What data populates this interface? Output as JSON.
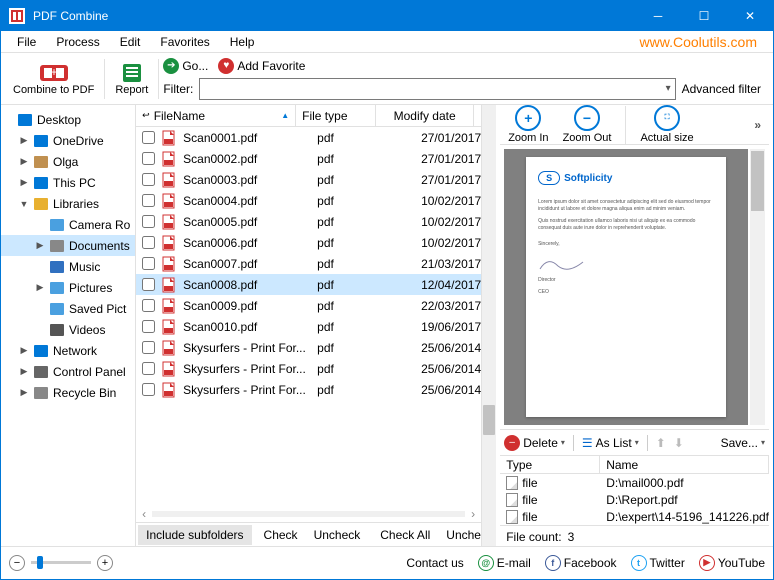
{
  "title": "PDF Combine",
  "brand_url": "www.Coolutils.com",
  "menu": [
    "File",
    "Process",
    "Edit",
    "Favorites",
    "Help"
  ],
  "toolbar": {
    "combine": "Combine to PDF",
    "report": "Report",
    "go": "Go...",
    "add_fav": "Add Favorite",
    "filter_label": "Filter:",
    "advanced": "Advanced filter"
  },
  "tree": [
    {
      "label": "Desktop",
      "icon": "desktop",
      "exp": "",
      "color": "#0078d7"
    },
    {
      "label": "OneDrive",
      "icon": "cloud",
      "exp": "▶",
      "color": "#0078d7",
      "indent": 1
    },
    {
      "label": "Olga",
      "icon": "user",
      "exp": "▶",
      "color": "#c09050",
      "indent": 1
    },
    {
      "label": "This PC",
      "icon": "pc",
      "exp": "▶",
      "color": "#0078d7",
      "indent": 1
    },
    {
      "label": "Libraries",
      "icon": "lib",
      "exp": "▼",
      "color": "#e8b030",
      "indent": 1
    },
    {
      "label": "Camera Ro",
      "icon": "pic",
      "exp": "",
      "color": "#4aa0e0",
      "indent": 2
    },
    {
      "label": "Documents",
      "icon": "doc",
      "exp": "▶",
      "color": "#888",
      "indent": 2,
      "selected": true
    },
    {
      "label": "Music",
      "icon": "music",
      "exp": "",
      "color": "#3070c0",
      "indent": 2
    },
    {
      "label": "Pictures",
      "icon": "pic",
      "exp": "▶",
      "color": "#4aa0e0",
      "indent": 2
    },
    {
      "label": "Saved Pict",
      "icon": "pic",
      "exp": "",
      "color": "#4aa0e0",
      "indent": 2
    },
    {
      "label": "Videos",
      "icon": "vid",
      "exp": "",
      "color": "#555",
      "indent": 2
    },
    {
      "label": "Network",
      "icon": "net",
      "exp": "▶",
      "color": "#0078d7",
      "indent": 1
    },
    {
      "label": "Control Panel",
      "icon": "ctrl",
      "exp": "▶",
      "color": "#666",
      "indent": 1
    },
    {
      "label": "Recycle Bin",
      "icon": "bin",
      "exp": "▶",
      "color": "#888",
      "indent": 1
    }
  ],
  "columns": {
    "name": "FileName",
    "type": "File type",
    "date": "Modify date"
  },
  "files": [
    {
      "name": "Scan0001.pdf",
      "type": "pdf",
      "date": "27/01/2017"
    },
    {
      "name": "Scan0002.pdf",
      "type": "pdf",
      "date": "27/01/2017"
    },
    {
      "name": "Scan0003.pdf",
      "type": "pdf",
      "date": "27/01/2017"
    },
    {
      "name": "Scan0004.pdf",
      "type": "pdf",
      "date": "10/02/2017"
    },
    {
      "name": "Scan0005.pdf",
      "type": "pdf",
      "date": "10/02/2017"
    },
    {
      "name": "Scan0006.pdf",
      "type": "pdf",
      "date": "10/02/2017"
    },
    {
      "name": "Scan0007.pdf",
      "type": "pdf",
      "date": "21/03/2017"
    },
    {
      "name": "Scan0008.pdf",
      "type": "pdf",
      "date": "12/04/2017",
      "selected": true
    },
    {
      "name": "Scan0009.pdf",
      "type": "pdf",
      "date": "22/03/2017"
    },
    {
      "name": "Scan0010.pdf",
      "type": "pdf",
      "date": "19/06/2017"
    },
    {
      "name": "Skysurfers - Print For...",
      "type": "pdf",
      "date": "25/06/2014"
    },
    {
      "name": "Skysurfers - Print For...",
      "type": "pdf",
      "date": "25/06/2014"
    },
    {
      "name": "Skysurfers - Print For...",
      "type": "pdf",
      "date": "25/06/2014"
    }
  ],
  "center_footer": [
    "Include subfolders",
    "Check",
    "Uncheck",
    "Check All",
    "Unche"
  ],
  "zoom": {
    "in": "Zoom In",
    "out": "Zoom Out",
    "actual": "Actual size"
  },
  "preview": {
    "brand": "Softplicity"
  },
  "queue_tb": {
    "delete": "Delete",
    "aslist": "As List",
    "save": "Save..."
  },
  "queue_cols": {
    "type": "Type",
    "name": "Name"
  },
  "queue": [
    {
      "type": "file",
      "name": "D:\\mail000.pdf"
    },
    {
      "type": "file",
      "name": "D:\\Report.pdf"
    },
    {
      "type": "file",
      "name": "D:\\expert\\14-5196_141226.pdf"
    }
  ],
  "file_count_label": "File count:",
  "file_count": "3",
  "status": {
    "contact": "Contact us",
    "email": "E-mail",
    "facebook": "Facebook",
    "twitter": "Twitter",
    "youtube": "YouTube"
  }
}
